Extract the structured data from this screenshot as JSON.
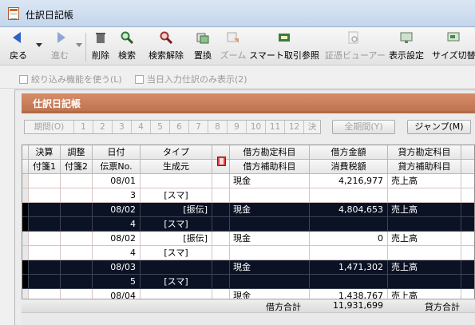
{
  "window": {
    "title": "仕訳日記帳"
  },
  "toolbar": {
    "items": [
      {
        "label": "戻る",
        "icon": "back-arrow-icon"
      },
      {
        "label": "進む",
        "icon": "forward-arrow-icon"
      },
      {
        "label": "削除",
        "icon": "trash-icon"
      },
      {
        "label": "検索",
        "icon": "magnifier-icon"
      },
      {
        "label": "検索解除",
        "icon": "search-clear-icon"
      },
      {
        "label": "置換",
        "icon": "replace-icon"
      },
      {
        "label": "ズーム",
        "icon": "zoom-icon"
      },
      {
        "label": "スマート取引参照",
        "icon": "smart-transaction-icon"
      },
      {
        "label": "証憑ビューアー",
        "icon": "voucher-viewer-icon"
      },
      {
        "label": "表示設定",
        "icon": "display-settings-icon"
      },
      {
        "label": "サイズ切替",
        "icon": "size-toggle-icon"
      }
    ]
  },
  "options": {
    "narrow": "絞り込み機能を使う(L)",
    "today": "当日入力仕訳のみ表示(2)"
  },
  "panel": {
    "title": "仕訳日記帳"
  },
  "period": {
    "label": "期間(O)",
    "months": [
      "1",
      "2",
      "3",
      "4",
      "5",
      "6",
      "7",
      "8",
      "9",
      "10",
      "11",
      "12",
      "決"
    ],
    "all": "全期間(Y)",
    "jump": "ジャンプ(M)"
  },
  "grid": {
    "headers_top": [
      "決算",
      "調整",
      "日付",
      "タイプ",
      "",
      "借方勘定科目",
      "借方金額",
      "貸方勘定科目"
    ],
    "headers_bottom": [
      "付箋1",
      "付箋2",
      "伝票No.",
      "生成元",
      "",
      "借方補助科目",
      "消費税額",
      "貸方補助科目"
    ],
    "rows": [
      {
        "date": "08/01",
        "type": "",
        "no": "3",
        "source": "[スマ]",
        "debit_account": "現金",
        "debit_amount": "4,216,977",
        "credit_account": "売上高",
        "dark": false
      },
      {
        "date": "08/02",
        "type": "[振伝]",
        "no": "4",
        "source": "[スマ]",
        "debit_account": "現金",
        "debit_amount": "4,804,653",
        "credit_account": "売上高",
        "dark": true
      },
      {
        "date": "08/02",
        "type": "[振伝]",
        "no": "4",
        "source": "[スマ]",
        "debit_account": "現金",
        "debit_amount": "0",
        "credit_account": "売上高",
        "dark": false
      },
      {
        "date": "08/03",
        "type": "",
        "no": "5",
        "source": "[スマ]",
        "debit_account": "現金",
        "debit_amount": "1,471,302",
        "credit_account": "売上高",
        "dark": true
      },
      {
        "date": "08/04",
        "type": "",
        "no": "",
        "source": "",
        "debit_account": "現金",
        "debit_amount": "1,438,767",
        "credit_account": "売上高",
        "dark": false
      }
    ],
    "footer": {
      "debit_total_label": "借方合計",
      "debit_total": "11,931,699",
      "credit_total_label": "貸方合計"
    }
  },
  "colors": {
    "dark_row": "#0b1224",
    "panel_header": "#c87a55"
  }
}
